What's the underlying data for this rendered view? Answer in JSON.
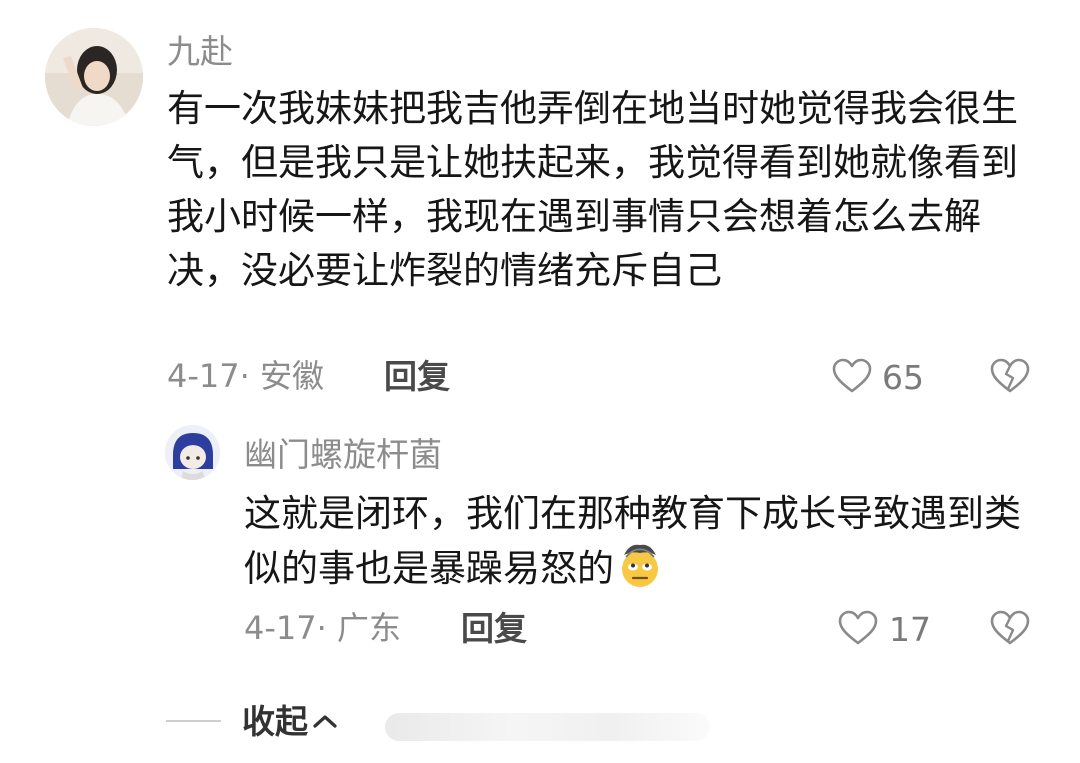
{
  "comments": [
    {
      "username": "九赴",
      "text": "有一次我妹妹把我吉他弄倒在地当时她觉得我会很生气，但是我只是让她扶起来，我觉得看到她就像看到我小时候一样，我现在遇到事情只会想着怎么去解决，没必要让炸裂的情绪充斥自己",
      "meta": "4-17· 安徽",
      "reply_label": "回复",
      "likes": "65",
      "like_icon": "heart-outline-icon",
      "dislike_icon": "broken-heart-icon"
    },
    {
      "username": "幽门螺旋杆菌",
      "text": "这就是闭环，我们在那种教育下成长导致遇到类似的事也是暴躁易怒的",
      "emoji": "face-with-spiral-eyes-rolling-emoji",
      "meta": "4-17· 广东",
      "reply_label": "回复",
      "likes": "17",
      "like_icon": "heart-outline-icon",
      "dislike_icon": "broken-heart-icon"
    }
  ],
  "footer": {
    "collapse_label": "收起",
    "collapse_icon": "chevron-up-icon"
  },
  "colors": {
    "username": "#8c8c8c",
    "text": "#161616",
    "meta": "#8c8c8c",
    "icon": "#8a8a8a"
  }
}
